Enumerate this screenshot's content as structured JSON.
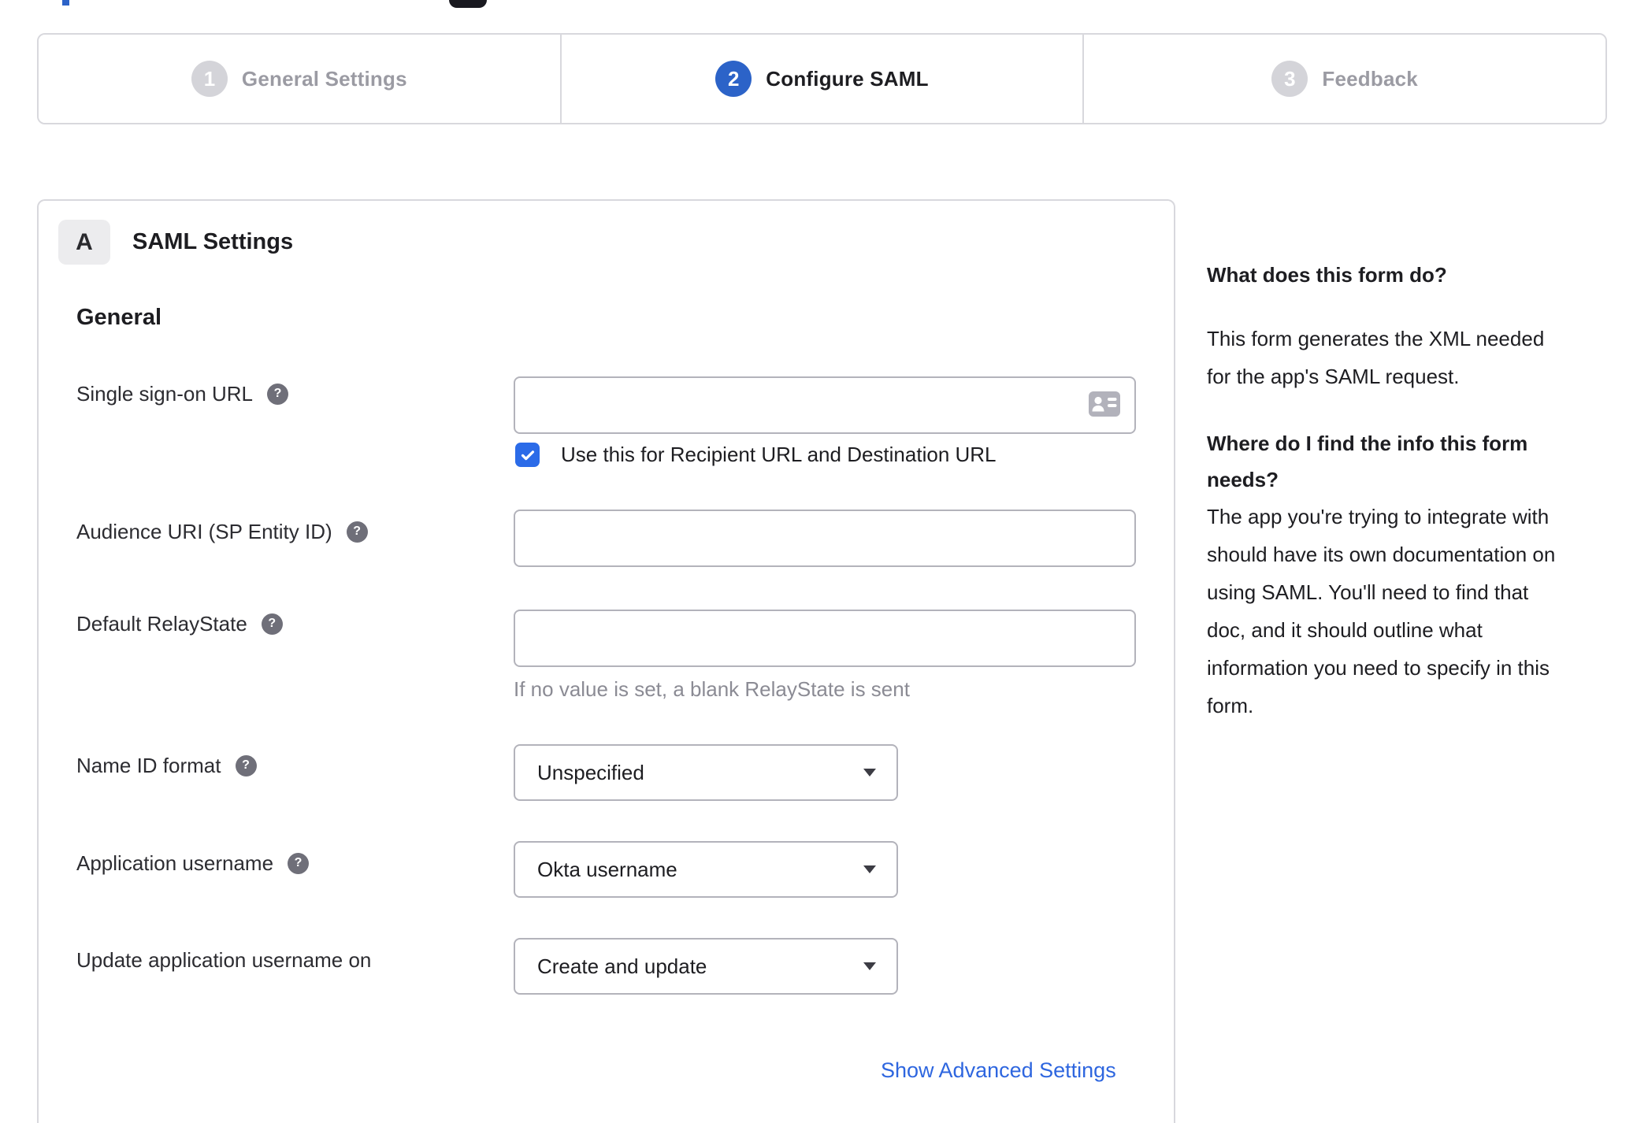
{
  "stepper": {
    "steps": [
      {
        "number": "1",
        "label": "General Settings",
        "state": "inactive"
      },
      {
        "number": "2",
        "label": "Configure SAML",
        "state": "active"
      },
      {
        "number": "3",
        "label": "Feedback",
        "state": "inactive"
      }
    ]
  },
  "panel": {
    "section_badge": "A",
    "section_title": "SAML Settings",
    "subsection_title": "General",
    "fields": {
      "sso_url": {
        "label": "Single sign-on URL",
        "value": "",
        "checkbox_label": "Use this for Recipient URL and Destination URL",
        "checkbox_checked": true
      },
      "audience_uri": {
        "label": "Audience URI (SP Entity ID)",
        "value": ""
      },
      "default_relay_state": {
        "label": "Default RelayState",
        "value": "",
        "helper": "If no value is set, a blank RelayState is sent"
      },
      "name_id_format": {
        "label": "Name ID format",
        "value": "Unspecified"
      },
      "application_username": {
        "label": "Application username",
        "value": "Okta username"
      },
      "update_app_username": {
        "label": "Update application username on",
        "value": "Create and update"
      }
    },
    "advanced_link": "Show Advanced Settings"
  },
  "help_sidebar": {
    "heading1": "What does this form do?",
    "paragraph1_lines": [
      "This form generates the XML needed",
      "for the app's SAML request."
    ],
    "heading2_lines": [
      "Where do I find the info this form",
      "needs?"
    ],
    "paragraph2_lines": [
      "The app you're trying to integrate with",
      "should have its own documentation on",
      "using SAML. You'll need to find that",
      "doc, and it should outline what",
      "information you need to specify in this",
      "form."
    ]
  },
  "icons": {
    "help": "?"
  },
  "colors": {
    "accent_blue": "#2c63c8",
    "checkbox_blue": "#2b6be8",
    "link_blue": "#2e66df",
    "border_grey": "#d8d8dd",
    "input_border_grey": "#b3b3bb",
    "inactive_grey": "#d4d4d9",
    "muted_text": "#9b9ba3",
    "helper_text": "#8b8b94",
    "help_icon_grey": "#6f6f79",
    "badge_bg": "#ececee"
  }
}
